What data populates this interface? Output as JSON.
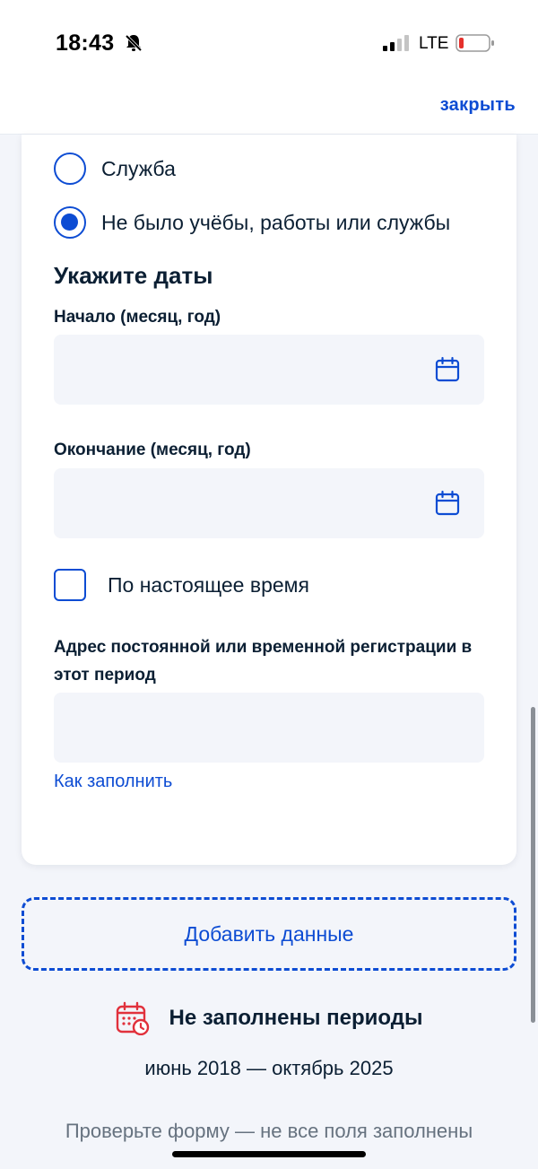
{
  "status_bar": {
    "time": "18:43",
    "network": "LTE",
    "icons": [
      "bell-off-icon",
      "signal-icon",
      "battery-low-icon"
    ]
  },
  "top_bar": {
    "close_label": "закрыть"
  },
  "form": {
    "radio_options": [
      {
        "label": "Служба",
        "checked": false
      },
      {
        "label": "Не было учёбы, работы или службы",
        "checked": true
      }
    ],
    "section_title": "Укажите даты",
    "start_label": "Начало (месяц, год)",
    "start_value": "",
    "end_label": "Окончание (месяц, год)",
    "end_value": "",
    "present_time_label": "По настоящее время",
    "present_time_checked": false,
    "address_label": "Адрес постоянной или временной регистрации в этот период",
    "address_value": "",
    "how_to_fill_label": "Как заполнить"
  },
  "add_button_label": "Добавить данные",
  "warning": {
    "title": "Не заполнены периоды",
    "range": "июнь 2018 — октябрь 2025",
    "note": "Проверьте форму — не все поля заполнены",
    "icon": "calendar-warning-icon"
  },
  "colors": {
    "accent": "#0d4cd3",
    "text": "#0b1f33",
    "field_bg": "#f3f5fa",
    "warning": "#e1313c",
    "muted": "#66727f"
  }
}
